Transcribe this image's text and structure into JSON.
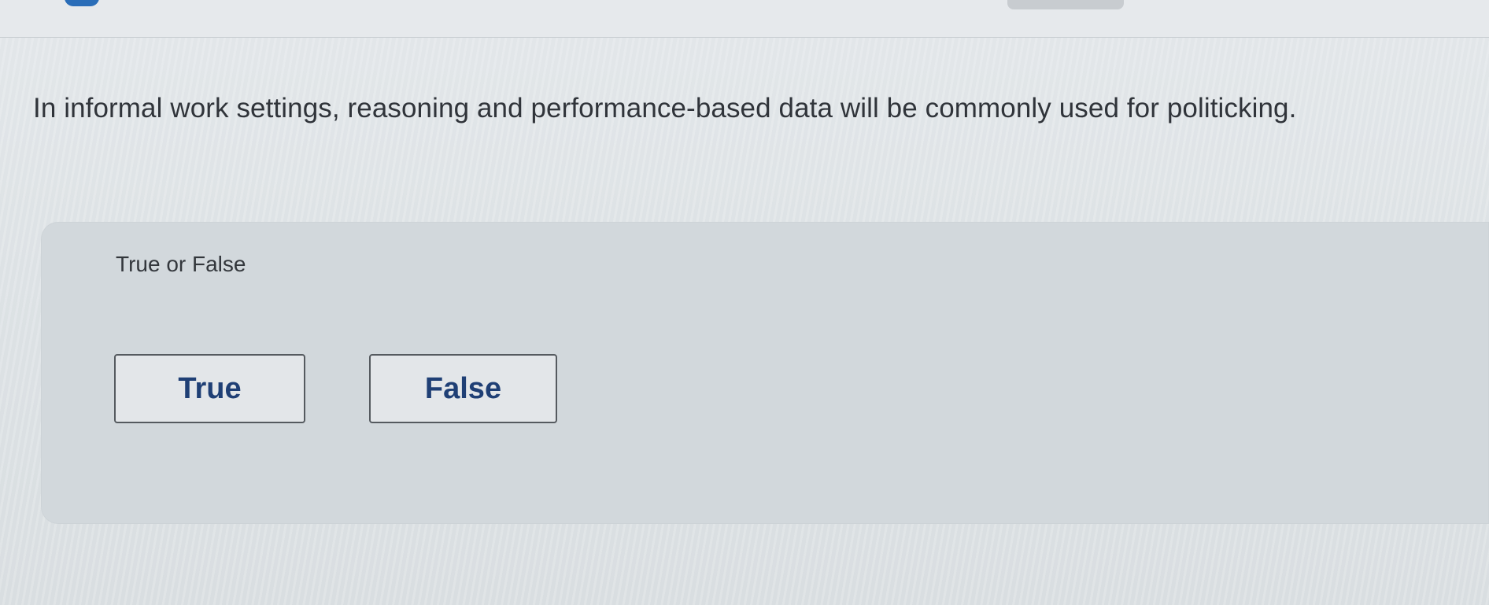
{
  "question": {
    "text": "In informal work settings, reasoning and performance-based data will be commonly used for politicking."
  },
  "answer_section": {
    "prompt": "True or False",
    "choices": [
      {
        "label": "True"
      },
      {
        "label": "False"
      }
    ]
  }
}
